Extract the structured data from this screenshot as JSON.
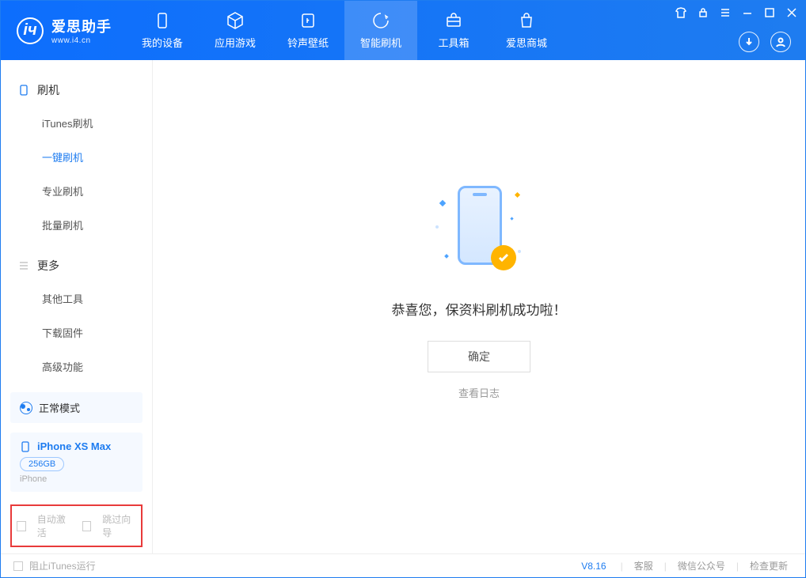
{
  "app": {
    "name": "爱思助手",
    "url": "www.i4.cn"
  },
  "nav": {
    "items": [
      {
        "label": "我的设备",
        "icon": "device"
      },
      {
        "label": "应用游戏",
        "icon": "cube"
      },
      {
        "label": "铃声壁纸",
        "icon": "music"
      },
      {
        "label": "智能刷机",
        "icon": "refresh"
      },
      {
        "label": "工具箱",
        "icon": "toolbox"
      },
      {
        "label": "爱思商城",
        "icon": "bag"
      }
    ],
    "active_index": 3
  },
  "sidebar": {
    "group1": {
      "title": "刷机",
      "items": [
        "iTunes刷机",
        "一键刷机",
        "专业刷机",
        "批量刷机"
      ],
      "active_index": 1
    },
    "group2": {
      "title": "更多",
      "items": [
        "其他工具",
        "下载固件",
        "高级功能"
      ]
    },
    "mode": {
      "label": "正常模式"
    },
    "device": {
      "name": "iPhone XS Max",
      "storage": "256GB",
      "type": "iPhone"
    },
    "checkboxes": {
      "auto_activate": "自动激活",
      "skip_guide": "跳过向导"
    }
  },
  "main": {
    "success_text": "恭喜您，保资料刷机成功啦！",
    "ok_button": "确定",
    "view_log": "查看日志"
  },
  "footer": {
    "block_itunes": "阻止iTunes运行",
    "version": "V8.16",
    "links": [
      "客服",
      "微信公众号",
      "检查更新"
    ]
  }
}
